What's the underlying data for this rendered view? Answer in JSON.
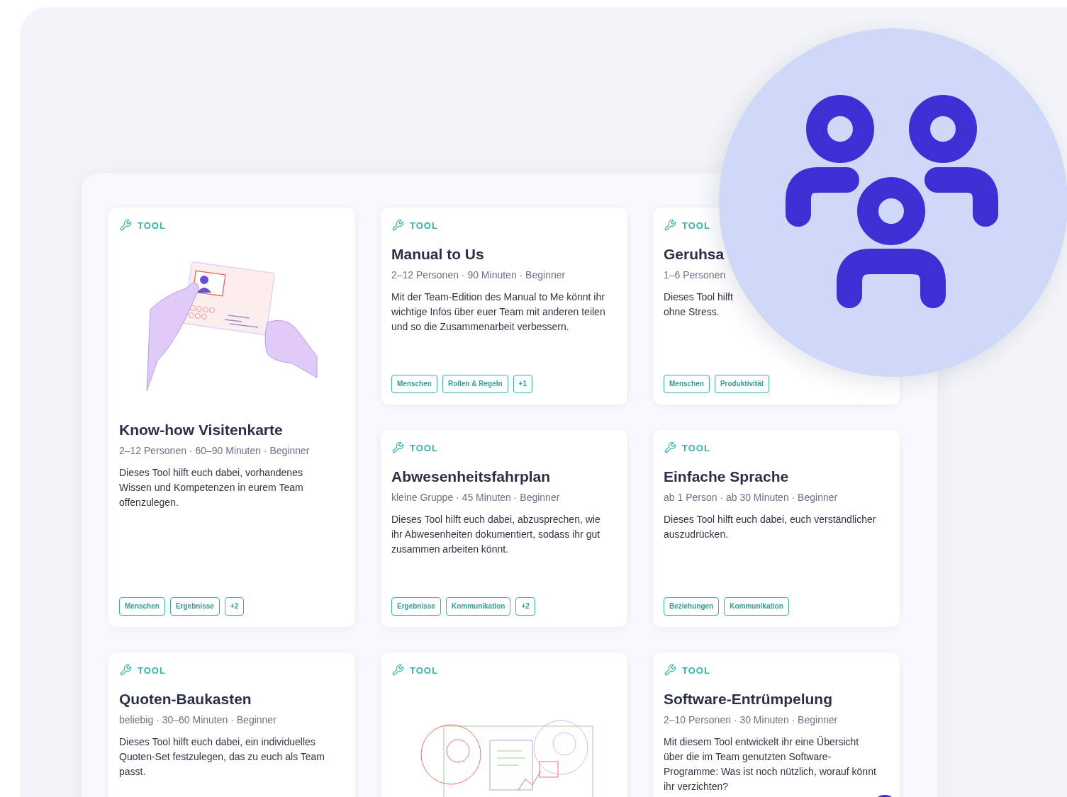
{
  "cards": [
    {
      "kind": "hands",
      "tag": "TOOL",
      "title": "Know-how Visitenkarte",
      "meta": "2–12 Personen · 60–90 Minuten · Beginner",
      "description": "Dieses Tool hilft euch dabei, vorhandenes Wissen und Kompetenzen in eurem Team offenzulegen.",
      "tags": [
        "Menschen",
        "Ergebnisse",
        "+2"
      ]
    },
    {
      "kind": "text",
      "tag": "TOOL",
      "title": "Manual to Us",
      "meta": "2–12 Personen · 90 Minuten · Beginner",
      "description": "Mit der Team-Edition des Manual to Me könnt ihr wichtige Infos über euer Team mit anderen teilen und so die Zusammenarbeit verbessern.",
      "tags": [
        "Menschen",
        "Rollen & Regeln",
        "+1"
      ]
    },
    {
      "kind": "text",
      "tag": "TOOL",
      "title": "Geruhsa",
      "meta": "1–6 Personen",
      "description": "Dieses Tool hilft\nohne Stress.",
      "tags": [
        "Menschen",
        "Produktivität"
      ]
    },
    {
      "kind": "text",
      "tag": "TOOL",
      "title": "Abwesenheitsfahrplan",
      "meta": "kleine Gruppe · 45 Minuten · Beginner",
      "description": "Dieses Tool hilft euch dabei, abzusprechen, wie ihr Abwesenheiten dokumentiert, sodass ihr gut zusammen arbeiten könnt.",
      "tags": [
        "Ergebnisse",
        "Kommunikation",
        "+2"
      ]
    },
    {
      "kind": "text",
      "tag": "TOOL",
      "title": "Einfache Sprache",
      "meta": "ab 1 Person · ab 30 Minuten · Beginner",
      "description": "Dieses Tool hilft euch dabei, euch verständlicher auszudrücken.",
      "tags": [
        "Beziehungen",
        "Kommunikation"
      ]
    },
    {
      "kind": "text",
      "tag": "TOOL",
      "title": "Quoten-Baukasten",
      "meta": "beliebig · 30–60 Minuten · Beginner",
      "description": "Dieses Tool hilft euch dabei, ein individuelles Quoten-Set festzulegen, das zu euch als Team passt."
    },
    {
      "kind": "desk",
      "tag": "TOOL"
    },
    {
      "kind": "text",
      "tag": "TOOL",
      "title": "Software-Entrümpelung",
      "meta": "2–10 Personen · 30 Minuten · Beginner",
      "description": "Mit diesem Tool entwickelt ihr eine Übersicht über die im Team genutzten Software-Programme: Was ist noch nützlich, worauf könnt ihr verzichten?"
    }
  ]
}
